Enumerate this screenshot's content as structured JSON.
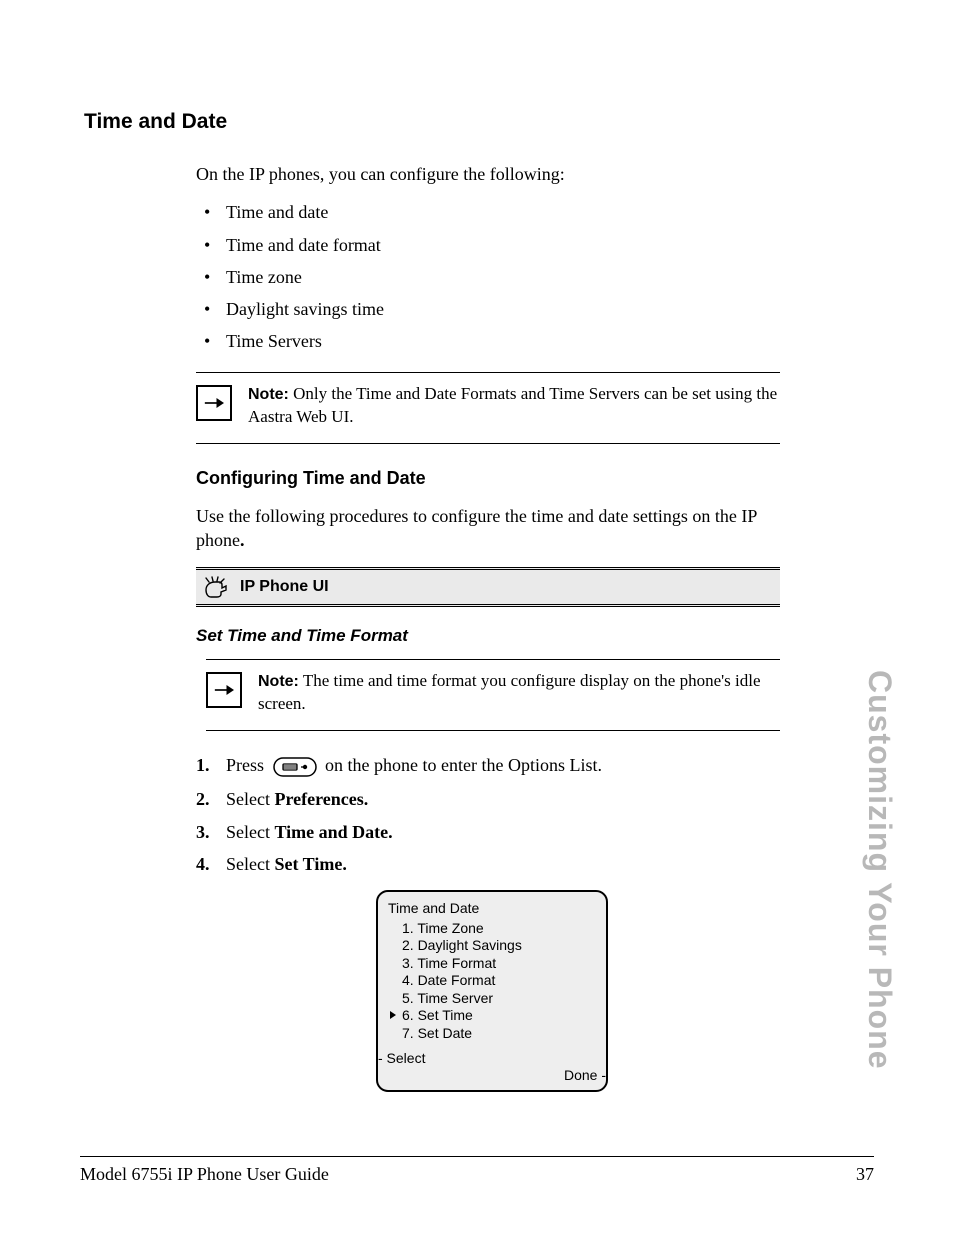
{
  "heading": "Time and Date",
  "intro": "On the IP phones, you can configure the following:",
  "bullets": [
    "Time and date",
    "Time and date format",
    "Time zone",
    "Daylight savings time",
    "Time Servers"
  ],
  "note1": {
    "label": "Note:",
    "text": "Only the Time and Date Formats and Time Servers can be set using the Aastra Web UI."
  },
  "sub1": "Configuring Time and Date",
  "sub1_text_a": "Use the following procedures to configure the time and date settings on the IP phone",
  "sub1_text_b": ".",
  "uibar": "IP Phone UI",
  "sub2": "Set Time and Time Format",
  "note2": {
    "label": "Note:",
    "text": "The time and time format you configure display on the phone's idle screen."
  },
  "steps": {
    "s1a": "Press ",
    "s1b": " on the phone to enter the Options List.",
    "s2a": "Select ",
    "s2b": "Preferences.",
    "s3a": "Select ",
    "s3b": "Time and Date.",
    "s4a": "Select ",
    "s4b": "Set Time."
  },
  "screen": {
    "title": "Time and Date",
    "items": [
      "1. Time Zone",
      "2. Daylight Savings",
      "3. Time Format",
      "4. Date Format",
      "5. Time Server",
      "6. Set Time",
      "7. Set Date"
    ],
    "selected_index": 5,
    "soft_left": "- Select",
    "soft_right": "Done -"
  },
  "sidetab": "Customizing Your Phone",
  "footer_left": "Model 6755i IP Phone User Guide",
  "footer_right": "37"
}
